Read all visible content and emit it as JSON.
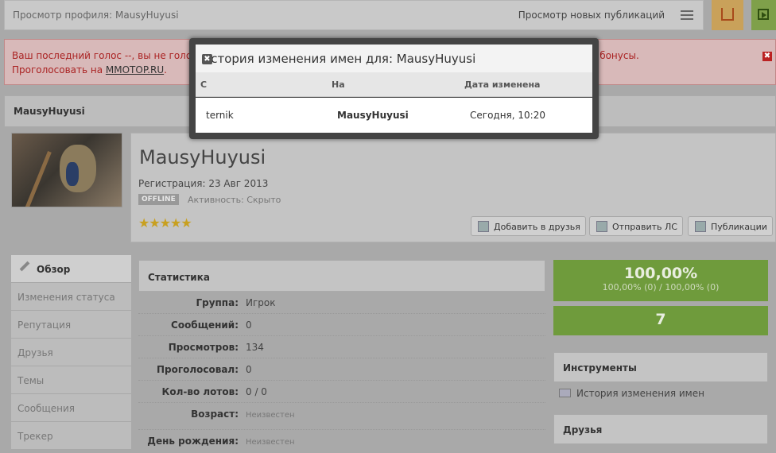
{
  "topbar": {
    "breadcrumb": "Просмотр профиля: MausyHuyusi",
    "new_publications": "Просмотр новых публикаций"
  },
  "alert": {
    "line1_left": "Ваш последний голос --, вы не голосов",
    "line1_right": "проекта, а вы получите бонусы.",
    "line2_prefix": "Проголосовать на ",
    "link": "MMOTOP.RU",
    "line2_suffix": ".",
    "close": "✖"
  },
  "profile": {
    "header": "MausyHuyusi",
    "name": "MausyHuyusi",
    "registration": "Регистрация: 23 Авг 2013",
    "status": "OFFLINE",
    "activity": "Активность: Скрыто",
    "stars": "★★★★★",
    "buttons": {
      "add_friend": "Добавить в друзья",
      "send_pm": "Отправить ЛС",
      "publications": "Публикации"
    }
  },
  "nav": {
    "items": [
      "Обзор",
      "Изменения статуса",
      "Репутация",
      "Друзья",
      "Темы",
      "Сообщения",
      "Трекер"
    ]
  },
  "stats": {
    "title": "Статистика",
    "rows": [
      {
        "k": "Группа:",
        "v": "Игрок"
      },
      {
        "k": "Сообщений:",
        "v": "0"
      },
      {
        "k": "Просмотров:",
        "v": "134"
      },
      {
        "k": "Проголосовал:",
        "v": "0"
      },
      {
        "k": "Кол-во лотов:",
        "v": "0 / 0"
      },
      {
        "k": "Возраст:",
        "v": "Неизвестен"
      },
      {
        "k": "День рождения:",
        "v": "Неизвестен"
      }
    ]
  },
  "right": {
    "percent": "100,00%",
    "percent_detail": "100,00% (0)  /  100,00% (0)",
    "count": "7",
    "tools_title": "Инструменты",
    "tool_item": "История изменения имен",
    "friends_title": "Друзья"
  },
  "modal": {
    "title": "История изменения имен для: MausyHuyusi",
    "close": "✖",
    "columns": [
      "С",
      "На",
      "Дата изменена"
    ],
    "row": {
      "from": "ternik",
      "to": "MausyHuyusi",
      "date": "Сегодня, 10:20"
    }
  },
  "colors": {
    "green": "#6f9b3c",
    "alert_text": "#aa2222"
  }
}
